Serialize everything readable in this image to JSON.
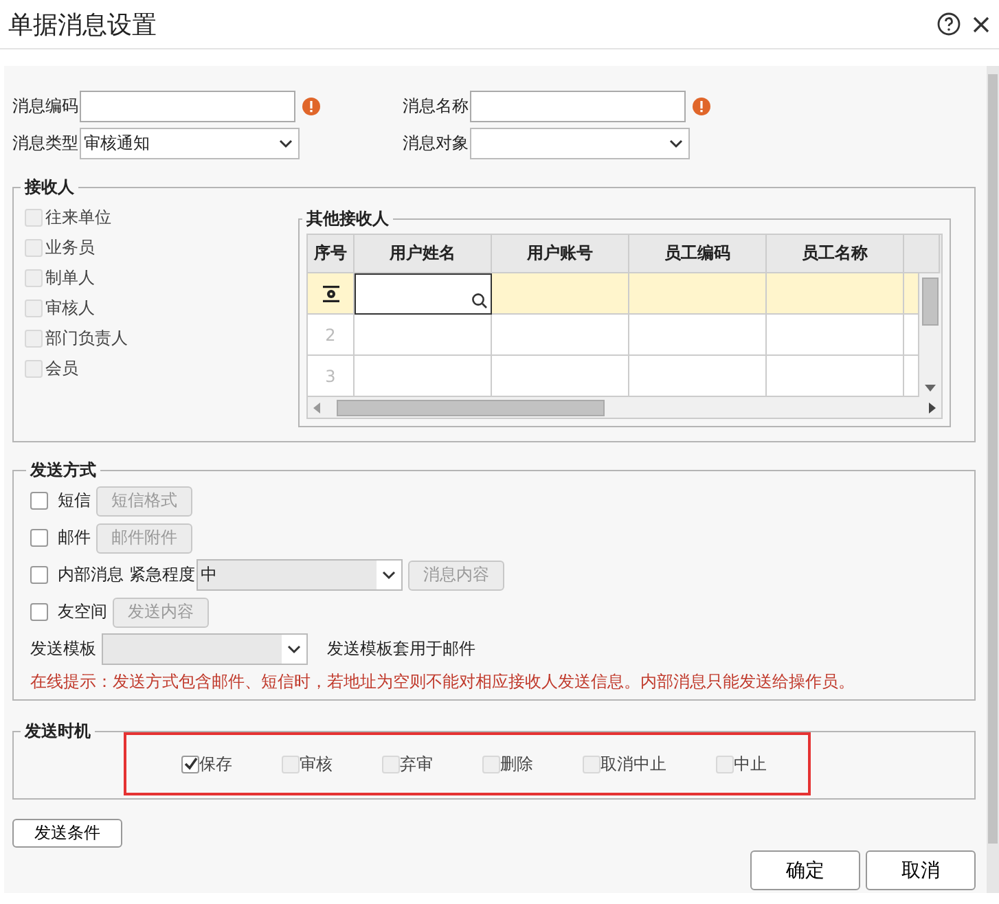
{
  "window": {
    "title": "单据消息设置"
  },
  "fields": [
    {
      "label": "消息编码",
      "kind": "text",
      "required": true
    },
    {
      "label": "消息名称",
      "kind": "text",
      "required": true
    },
    {
      "label": "消息类型",
      "kind": "select",
      "value": "审核通知"
    },
    {
      "label": "消息对象",
      "kind": "select"
    }
  ],
  "recipients": {
    "title": "接收人",
    "options": [
      {
        "label": "往来单位",
        "checked": false
      },
      {
        "label": "业务员",
        "checked": false
      },
      {
        "label": "制单人",
        "checked": false
      },
      {
        "label": "审核人",
        "checked": false
      },
      {
        "label": "部门负责人",
        "checked": false
      },
      {
        "label": "会员",
        "checked": false
      }
    ]
  },
  "other_recipients": {
    "title": "其他接收人",
    "columns": [
      "序号",
      "用户姓名",
      "用户账号",
      "员工编码",
      "员工名称"
    ],
    "rows": [
      {
        "selected": true
      },
      {
        "number": "2",
        "selected": false
      },
      {
        "number": "3",
        "selected": false
      }
    ]
  },
  "send_method": {
    "title": "发送方式",
    "methods": [
      {
        "label": "短信",
        "checked": false,
        "button": {
          "label": "短信格式",
          "disabled": true
        }
      },
      {
        "label": "邮件",
        "checked": false,
        "button": {
          "label": "邮件附件",
          "disabled": true
        }
      },
      {
        "label": "内部消息",
        "checked": false,
        "urgency_label": "紧急程度",
        "urgency": "中",
        "button": {
          "label": "消息内容",
          "disabled": true
        }
      },
      {
        "label": "友空间",
        "checked": false,
        "button": {
          "label": "发送内容",
          "disabled": true
        }
      }
    ],
    "template_label": "发送模板",
    "template_note": "发送模板套用于邮件",
    "hint": "在线提示：发送方式包含邮件、短信时，若地址为空则不能对相应接收人发送信息。内部消息只能发送给操作员。"
  },
  "send_timing": {
    "title": "发送时机",
    "highlighted": true,
    "options": [
      {
        "label": "保存",
        "checked": true
      },
      {
        "label": "审核",
        "checked": false
      },
      {
        "label": "弃审",
        "checked": false
      },
      {
        "label": "删除",
        "checked": false
      },
      {
        "label": "取消中止",
        "checked": false
      },
      {
        "label": "中止",
        "checked": false
      }
    ]
  },
  "condition_button": "发送条件",
  "buttons": [
    "确定",
    "取消"
  ]
}
